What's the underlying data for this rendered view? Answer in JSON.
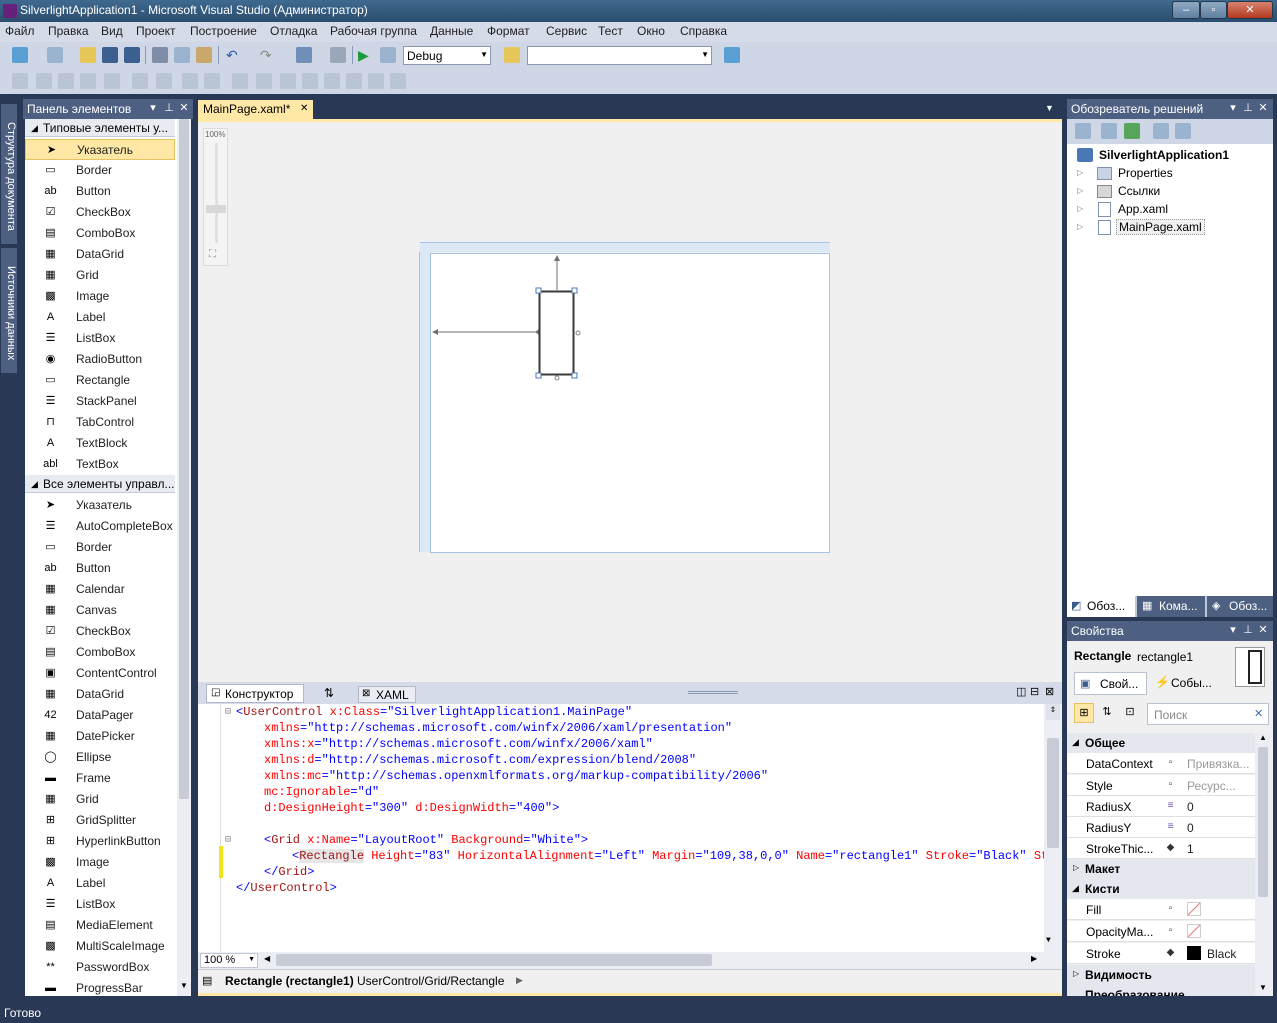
{
  "window": {
    "title": "SilverlightApplication1 - Microsoft Visual Studio (Администратор)",
    "min": "‒",
    "max": "▫",
    "close": "✕"
  },
  "menu": [
    "Файл",
    "Правка",
    "Вид",
    "Проект",
    "Построение",
    "Отладка",
    "Рабочая группа",
    "Данные",
    "Формат",
    "Сервис",
    "Тест",
    "Окно",
    "Справка"
  ],
  "toolbar": {
    "config": "Debug",
    "platform": ""
  },
  "left_rail": {
    "doc_outline": "Структура документа",
    "data_sources": "Источники данных"
  },
  "toolbox": {
    "title": "Панель элементов",
    "group1": "Типовые элементы у...",
    "items1": [
      {
        "label": "Указатель",
        "icon": "pointer-icon",
        "glyph": "➤"
      },
      {
        "label": "Border",
        "icon": "border-icon",
        "glyph": "▭"
      },
      {
        "label": "Button",
        "icon": "button-icon",
        "glyph": "ab"
      },
      {
        "label": "CheckBox",
        "icon": "checkbox-icon",
        "glyph": "☑"
      },
      {
        "label": "ComboBox",
        "icon": "combobox-icon",
        "glyph": "▤"
      },
      {
        "label": "DataGrid",
        "icon": "datagrid-icon",
        "glyph": "▦"
      },
      {
        "label": "Grid",
        "icon": "grid-icon",
        "glyph": "▦"
      },
      {
        "label": "Image",
        "icon": "image-icon",
        "glyph": "▩"
      },
      {
        "label": "Label",
        "icon": "label-icon",
        "glyph": "A"
      },
      {
        "label": "ListBox",
        "icon": "listbox-icon",
        "glyph": "☰"
      },
      {
        "label": "RadioButton",
        "icon": "radiobutton-icon",
        "glyph": "◉"
      },
      {
        "label": "Rectangle",
        "icon": "rectangle-icon",
        "glyph": "▭"
      },
      {
        "label": "StackPanel",
        "icon": "stackpanel-icon",
        "glyph": "☰"
      },
      {
        "label": "TabControl",
        "icon": "tabcontrol-icon",
        "glyph": "⊓"
      },
      {
        "label": "TextBlock",
        "icon": "textblock-icon",
        "glyph": "A"
      },
      {
        "label": "TextBox",
        "icon": "textbox-icon",
        "glyph": "abl"
      }
    ],
    "group2": "Все элементы управл...",
    "items2": [
      {
        "label": "Указатель",
        "icon": "pointer-icon",
        "glyph": "➤"
      },
      {
        "label": "AutoCompleteBox",
        "icon": "autocompletebox-icon",
        "glyph": "☰"
      },
      {
        "label": "Border",
        "icon": "border-icon",
        "glyph": "▭"
      },
      {
        "label": "Button",
        "icon": "button-icon",
        "glyph": "ab"
      },
      {
        "label": "Calendar",
        "icon": "calendar-icon",
        "glyph": "▦"
      },
      {
        "label": "Canvas",
        "icon": "canvas-icon",
        "glyph": "▦"
      },
      {
        "label": "CheckBox",
        "icon": "checkbox-icon",
        "glyph": "☑"
      },
      {
        "label": "ComboBox",
        "icon": "combobox-icon",
        "glyph": "▤"
      },
      {
        "label": "ContentControl",
        "icon": "contentcontrol-icon",
        "glyph": "▣"
      },
      {
        "label": "DataGrid",
        "icon": "datagrid-icon",
        "glyph": "▦"
      },
      {
        "label": "DataPager",
        "icon": "datapager-icon",
        "glyph": "42"
      },
      {
        "label": "DatePicker",
        "icon": "datepicker-icon",
        "glyph": "▦"
      },
      {
        "label": "Ellipse",
        "icon": "ellipse-icon",
        "glyph": "◯"
      },
      {
        "label": "Frame",
        "icon": "frame-icon",
        "glyph": "▬"
      },
      {
        "label": "Grid",
        "icon": "grid-icon",
        "glyph": "▦"
      },
      {
        "label": "GridSplitter",
        "icon": "gridsplitter-icon",
        "glyph": "⊞"
      },
      {
        "label": "HyperlinkButton",
        "icon": "hyperlinkbutton-icon",
        "glyph": "⊞"
      },
      {
        "label": "Image",
        "icon": "image-icon",
        "glyph": "▩"
      },
      {
        "label": "Label",
        "icon": "label-icon",
        "glyph": "A"
      },
      {
        "label": "ListBox",
        "icon": "listbox-icon",
        "glyph": "☰"
      },
      {
        "label": "MediaElement",
        "icon": "mediaelement-icon",
        "glyph": "▤"
      },
      {
        "label": "MultiScaleImage",
        "icon": "multiscaleimage-icon",
        "glyph": "▩"
      },
      {
        "label": "PasswordBox",
        "icon": "passwordbox-icon",
        "glyph": "**"
      },
      {
        "label": "ProgressBar",
        "icon": "progressbar-icon",
        "glyph": "▬"
      }
    ]
  },
  "doc": {
    "tab": "MainPage.xaml*",
    "zoom_top": "100%"
  },
  "split": {
    "designer_tab": "Конструктор",
    "swap": "⇅",
    "xaml_tab": "XAML"
  },
  "xaml": {
    "l1a": "<",
    "l1b": "UserControl",
    "l1c": " x:Class",
    "l1d": "=",
    "l1e": "\"SilverlightApplication1.MainPage\"",
    "l2a": "xmlns",
    "l2b": "=",
    "l2c": "\"http://schemas.microsoft.com/winfx/2006/xaml/presentation\"",
    "l3a": "xmlns:x",
    "l3b": "=",
    "l3c": "\"http://schemas.microsoft.com/winfx/2006/xaml\"",
    "l4a": "xmlns:d",
    "l4b": "=",
    "l4c": "\"http://schemas.microsoft.com/expression/blend/2008\"",
    "l5a": "xmlns:mc",
    "l5b": "=",
    "l5c": "\"http://schemas.openxmlformats.org/markup-compatibility/2006\"",
    "l6a": "mc:Ignorable",
    "l6b": "=",
    "l6c": "\"d\"",
    "l7a": "d:DesignHeight",
    "l7b": "=",
    "l7c": "\"300\"",
    "l7d": " d:DesignWidth",
    "l7e": "=",
    "l7f": "\"400\"",
    "l7g": ">",
    "l9a": "<",
    "l9b": "Grid",
    "l9c": " x:Name",
    "l9d": "=",
    "l9e": "\"LayoutRoot\"",
    "l9f": " Background",
    "l9g": "=",
    "l9h": "\"White\"",
    "l9i": ">",
    "l10a": "<",
    "l10b": "Rectangle",
    "l10c": " Height",
    "l10d": "=",
    "l10e": "\"83\"",
    "l10f": " HorizontalAlignment",
    "l10g": "=",
    "l10h": "\"Left\"",
    "l10i": " Margin",
    "l10j": "=",
    "l10k": "\"109,38,0,0\"",
    "l10l": " Name",
    "l10m": "=",
    "l10n": "\"rectangle1\"",
    "l10o": " Stroke",
    "l10p": "=",
    "l10q": "\"Black\"",
    "l10r": " Strok",
    "l11a": "</",
    "l11b": "Grid",
    "l11c": ">",
    "l12a": "</",
    "l12b": "UserControl",
    "l12c": ">"
  },
  "bottom": {
    "zoom": "100 %",
    "crumb_bold": "Rectangle (rectangle1)",
    "crumb_path": "UserControl/Grid/Rectangle"
  },
  "solution": {
    "title": "Обозреватель решений",
    "root": "SilverlightApplication1",
    "items": [
      "Properties",
      "Ссылки",
      "App.xaml",
      "MainPage.xaml"
    ],
    "tabs": [
      "Обоз...",
      "Кома...",
      "Обоз..."
    ]
  },
  "props": {
    "title": "Свойства",
    "type": "Rectangle",
    "name": "rectangle1",
    "tab_props": "Свой...",
    "tab_events": "Собы...",
    "search_placeholder": "Поиск",
    "cat_general": "Общее",
    "rows_general": [
      {
        "name": "DataContext",
        "value": "Привязка..."
      },
      {
        "name": "Style",
        "value": "Ресурс..."
      },
      {
        "name": "RadiusX",
        "value": "0"
      },
      {
        "name": "RadiusY",
        "value": "0"
      },
      {
        "name": "StrokeThic...",
        "value": "1"
      }
    ],
    "cat_layout": "Макет",
    "cat_brushes": "Кисти",
    "rows_brushes": [
      {
        "name": "Fill",
        "value": ""
      },
      {
        "name": "OpacityMa...",
        "value": ""
      },
      {
        "name": "Stroke",
        "value": "Black"
      }
    ],
    "cat_visibility": "Видимость",
    "cat_transform": "Преобразование"
  },
  "status": {
    "text": "Готово"
  },
  "colors": {
    "accent": "#293955",
    "selection": "#ffe8a6",
    "panel_title": "#4d6082"
  }
}
